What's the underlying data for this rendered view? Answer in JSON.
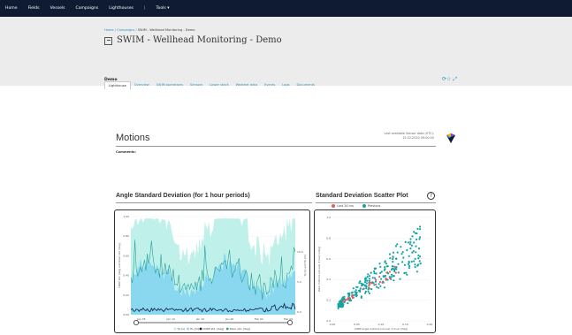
{
  "topnav": {
    "items": [
      "Home",
      "Fields",
      "Vessels",
      "Campaigns",
      "Lighthouses",
      "|",
      "Tools ▾"
    ]
  },
  "breadcrumb": {
    "home": "Home /",
    "campaigns": "Campaigns /",
    "current": "SWIM - Wellhead Monitoring - Demo"
  },
  "page": {
    "title": "SWIM - Wellhead Monitoring - Demo"
  },
  "tabs": [
    "Lighthouse",
    "Overview",
    "SWIM operations",
    "Sensors",
    "Lower stack",
    "Weather data",
    "Events",
    "Logs",
    "Documents"
  ],
  "active_tab": "Lighthouse",
  "section": {
    "label": "Demo"
  },
  "motions": {
    "title": "Motions",
    "last_sensor_label": "Last available Sensor data (UTC):",
    "last_sensor_value": "15.02.2020 09:00:00",
    "comments_label": "Comments:"
  },
  "angle_chart": {
    "title": "Angle Standard Deviation (for 1 hour periods)",
    "ylabel_left": "LMRP std. [deg] and Riser std. [deg]",
    "ylabel_right": "Tp [s] and Hs [m]",
    "xticks": [
      "Jan 05",
      "Jan 12",
      "Jan 19",
      "Jan 26",
      "Feb 02",
      "Feb 09"
    ],
    "yticks_left": [
      "1.00",
      "0.80",
      "0.60",
      "0.40",
      "0.20",
      "0.00"
    ],
    "yticks_right": [
      "10.0",
      "5.0",
      "0.0"
    ],
    "legend": [
      "Tp [s]",
      "Hs [m]",
      "LMRP std. [deg]",
      "Riser std. [deg]"
    ]
  },
  "scatter_chart": {
    "title": "Standard Deviation Scatter Plot",
    "legend": [
      "Last 24 hrs",
      "Previous"
    ],
    "xlabel": "LMRP angle motions (sd over 1 hour) [deg]",
    "ylabel": "Riser motions (sd over 1 hour) [deg]",
    "xticks": [
      "0.00",
      "0.05",
      "0.10",
      "0.15",
      "0.20"
    ],
    "yticks": [
      "0.0",
      "0.2",
      "0.4",
      "0.6",
      "0.8",
      "1.0"
    ]
  },
  "chart_data": [
    {
      "type": "line",
      "title": "Angle Standard Deviation (for 1 hour periods)",
      "x": [
        "Jan 05",
        "Jan 12",
        "Jan 19",
        "Jan 26",
        "Feb 02",
        "Feb 09"
      ],
      "ylim": [
        0,
        1.0
      ],
      "series": [
        {
          "name": "Riser std. [deg]",
          "values": [
            0.25,
            0.45,
            0.4,
            0.35,
            0.3,
            0.4
          ]
        },
        {
          "name": "LMRP std. [deg]",
          "values": [
            0.05,
            0.08,
            0.06,
            0.07,
            0.05,
            0.12
          ]
        }
      ],
      "colors": {
        "riser": "#2aa198",
        "lmrp": "#0d1b3d",
        "hs": "#7fd4f0",
        "tp": "#b8f0e8"
      }
    },
    {
      "type": "scatter",
      "title": "Standard Deviation Scatter Plot",
      "xlim": [
        0,
        0.2
      ],
      "ylim": [
        0,
        1.0
      ],
      "series": [
        {
          "name": "Previous",
          "color": "#12a4a4"
        },
        {
          "name": "Last 24 hrs",
          "color": "#e85b5b"
        }
      ]
    }
  ]
}
